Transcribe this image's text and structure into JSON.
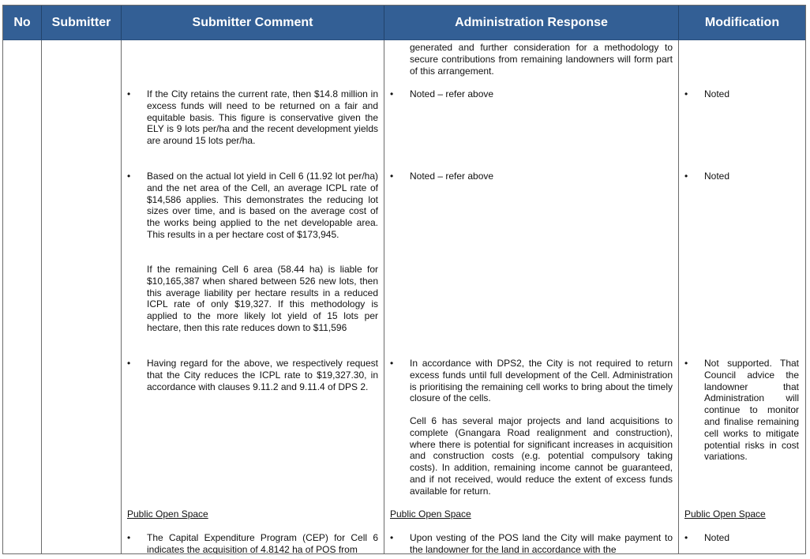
{
  "table": {
    "headers": {
      "no": "No",
      "submitter": "Submitter",
      "comment": "Submitter Comment",
      "response": "Administration Response",
      "modification": "Modification"
    },
    "header_color": "#335f95",
    "continuation": {
      "response": "generated and further consideration for a methodology to secure contributions from remaining landowners will form part of this arrangement."
    },
    "rows": [
      {
        "comment": "If the City retains the current rate, then $14.8 million in excess funds will need to be returned on a fair and equitable basis. This figure is conservative given the ELY is 9 lots per/ha and the recent development yields are around 15 lots per/ha.",
        "response": "Noted – refer above",
        "modification": "Noted"
      },
      {
        "comment": "Based on the actual lot yield in Cell 6 (11.92 lot per/ha) and the net area of the Cell, an average ICPL rate of $14,586 applies. This demonstrates the reducing lot sizes over time, and is based on the average cost of the works being applied to the net developable area. This results in a per hectare cost of $173,945.",
        "comment_2": "If the remaining Cell 6 area (58.44 ha) is liable for $10,165,387 when shared between 526 new lots, then this average liability per hectare results in a reduced ICPL rate of only $19,327. If this methodology is applied to the more likely lot yield of 15 lots per hectare, then this rate reduces down to $11,596",
        "response": "Noted – refer above",
        "modification": "Noted"
      },
      {
        "comment": "Having regard for the above, we respectively request that the City reduces the ICPL rate to $19,327.30, in accordance with clauses 9.11.2 and 9.11.4 of DPS 2.",
        "response": "In accordance with DPS2, the City is not required to return excess funds until full development of the Cell. Administration is prioritising the remaining cell works to bring about the timely closure of the cells.",
        "response_2": "Cell 6 has several major projects and land acquisitions to complete (Gnangara Road realignment and construction), where there is potential for significant increases in acquisition and construction costs (e.g. potential compulsory taking costs). In addition, remaining income cannot be guaranteed, and if not received, would reduce the extent of excess funds available for return.",
        "modification": "Not supported. That Council advice the landowner that Administration will continue to monitor and finalise remaining cell works to mitigate potential risks in cost variations."
      }
    ],
    "section": {
      "heading": "Public Open Space",
      "comment": "The Capital Expenditure Program (CEP) for Cell 6 indicates the acquisition of 4.8142 ha of POS from",
      "response": "Upon vesting of the POS land the City will make payment to the landowner for the land in accordance with the",
      "modification": "Noted"
    },
    "bullet_glyph": "•"
  }
}
